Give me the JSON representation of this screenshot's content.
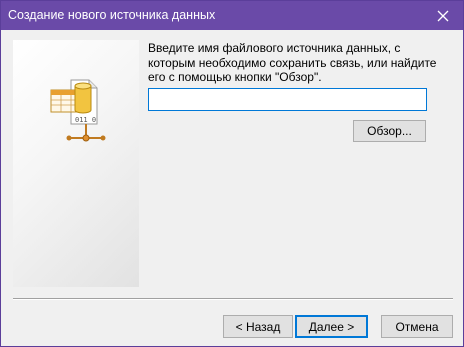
{
  "window": {
    "title": "Создание нового источника данных",
    "close_icon": "close-icon",
    "titlebar_color": "#6a4aa8"
  },
  "side_panel": {
    "icon": "data-source-connection-icon",
    "glyph_text": "011 0"
  },
  "main": {
    "instructions": "Введите имя файлового источника данных, с которым необходимо сохранить связь, или найдите его с помощью кнопки \"Обзор\".",
    "path_input_value": "",
    "browse_label": "Обзор..."
  },
  "footer": {
    "back_label": "< Назад",
    "next_label": "Далее >",
    "cancel_label": "Отмена",
    "accent_color": "#0078d7"
  }
}
